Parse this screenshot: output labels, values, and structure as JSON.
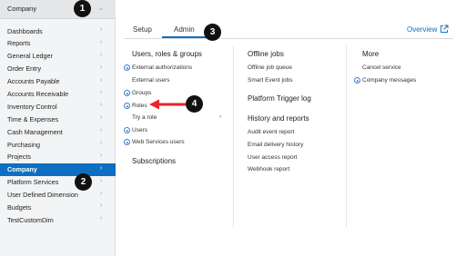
{
  "sidebar": {
    "header_label": "Company",
    "items": [
      {
        "label": "Dashboards",
        "active": false
      },
      {
        "label": "Reports",
        "active": false
      },
      {
        "label": "General Ledger",
        "active": false
      },
      {
        "label": "Order Entry",
        "active": false
      },
      {
        "label": "Accounts Payable",
        "active": false
      },
      {
        "label": "Accounts Receivable",
        "active": false
      },
      {
        "label": "Inventory Control",
        "active": false
      },
      {
        "label": "Time & Expenses",
        "active": false
      },
      {
        "label": "Cash Management",
        "active": false
      },
      {
        "label": "Purchasing",
        "active": false
      },
      {
        "label": "Projects",
        "active": false
      },
      {
        "label": "Company",
        "active": true
      },
      {
        "label": "Platform Services",
        "active": false
      },
      {
        "label": "User Defined Dimension",
        "active": false
      },
      {
        "label": "Budgets",
        "active": false
      },
      {
        "label": "TestCustomDim",
        "active": false
      }
    ]
  },
  "tabs": {
    "setup": "Setup",
    "admin": "Admin",
    "active": "Admin"
  },
  "overview_link": "Overview",
  "badges": {
    "b1": "1",
    "b2": "2",
    "b3": "3",
    "b4": "4"
  },
  "columns": {
    "col1": {
      "users_heading": "Users, roles & groups",
      "links": [
        {
          "label": "External authorizations",
          "plus": true
        },
        {
          "label": "External users",
          "plus": false
        },
        {
          "label": "Groups",
          "plus": true
        },
        {
          "label": "Roles",
          "plus": true
        },
        {
          "label": "Try a role",
          "plus": false,
          "submenu": true
        },
        {
          "label": "Users",
          "plus": true
        },
        {
          "label": "Web Services users",
          "plus": true
        }
      ],
      "subscriptions_heading": "Subscriptions"
    },
    "col2": {
      "offline_heading": "Offline jobs",
      "offline_links": [
        "Offline job queue",
        "Smart Event jobs"
      ],
      "platform_heading": "Platform Trigger log",
      "history_heading": "History and reports",
      "history_links": [
        "Audit event report",
        "Email delivery history",
        "User access report",
        "Webhook report"
      ]
    },
    "col3": {
      "more_heading": "More",
      "links": [
        {
          "label": "Cancel service",
          "plus": false
        },
        {
          "label": "Company messages",
          "plus": true
        }
      ]
    }
  },
  "colors": {
    "accent": "#0d6fc2",
    "annotation_red": "#e8252b",
    "badge": "#111111"
  }
}
